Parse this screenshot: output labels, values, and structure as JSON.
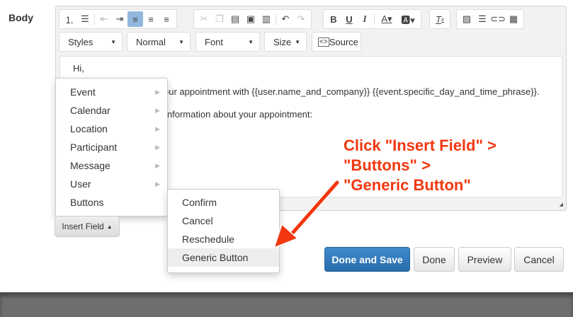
{
  "field_label": "Body",
  "toolbar": {
    "icons": [
      "numbered-list",
      "bulleted-list",
      "decrease-indent",
      "increase-indent",
      "align-left",
      "align-center",
      "align-right",
      "cut",
      "copy",
      "paste",
      "paste-text",
      "paste-word",
      "undo",
      "redo",
      "bold",
      "underline",
      "italic",
      "text-color",
      "background-color",
      "remove-format",
      "image",
      "horizontal-line",
      "link",
      "table"
    ],
    "styles": "Styles",
    "format": "Normal",
    "font": "Font",
    "size": "Size",
    "source": "Source"
  },
  "content": {
    "line1": "Hi,",
    "line2": "our appointment with {{user.name_and_company}} {{event.specific_day_and_time_phrase}}.",
    "line3": "information about your appointment:"
  },
  "insert_menu": {
    "items": [
      {
        "label": "Event",
        "submenu": true
      },
      {
        "label": "Calendar",
        "submenu": true
      },
      {
        "label": "Location",
        "submenu": true
      },
      {
        "label": "Participant",
        "submenu": true
      },
      {
        "label": "Message",
        "submenu": true
      },
      {
        "label": "User",
        "submenu": true
      },
      {
        "label": "Buttons",
        "submenu": false
      }
    ]
  },
  "buttons_submenu": {
    "items": [
      "Confirm",
      "Cancel",
      "Reschedule",
      "Generic Button"
    ],
    "highlighted": "Generic Button"
  },
  "insert_field_label": "Insert Field",
  "actions": {
    "done_and_save": "Done and Save",
    "done": "Done",
    "preview": "Preview",
    "cancel": "Cancel"
  },
  "annotation": {
    "line1": "Click \"Insert Field\" >",
    "line2": "\"Buttons\" >",
    "line3": "\"Generic Button\"",
    "color": "#f2370f"
  }
}
